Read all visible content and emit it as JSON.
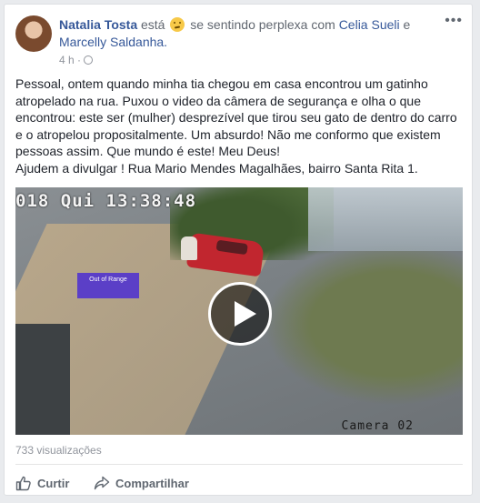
{
  "post": {
    "author": "Natalia Tosta",
    "verb": "está",
    "feeling_text": "se sentindo perplexa com",
    "tagged_1": "Celia Sueli",
    "conjunction": "e",
    "tagged_2": "Marcelly Saldanha.",
    "time": "4 h ·",
    "paragraph_1": "Pessoal, ontem quando minha tia chegou em casa encontrou um gatinho atropelado na rua. Puxou o video da câmera de segurança e olha o que encontrou: este ser (mulher) desprezível que tirou seu gato de dentro do carro e o atropelou propositalmente. Um absurdo! Não me conformo que existem pessoas assim. Que mundo é este! Meu Deus!",
    "paragraph_2": "Ajudem a divulgar ! Rua Mario Mendes Magalhães, bairro Santa Rita 1."
  },
  "video": {
    "timestamp": "018 Qui 13:38:48",
    "range_label": "Out of Range",
    "camera_label": "Camera 02",
    "views": "733 visualizações"
  },
  "actions": {
    "like": "Curtir",
    "share": "Compartilhar"
  },
  "colors": {
    "link": "#365899",
    "background": "#e9ebee"
  }
}
